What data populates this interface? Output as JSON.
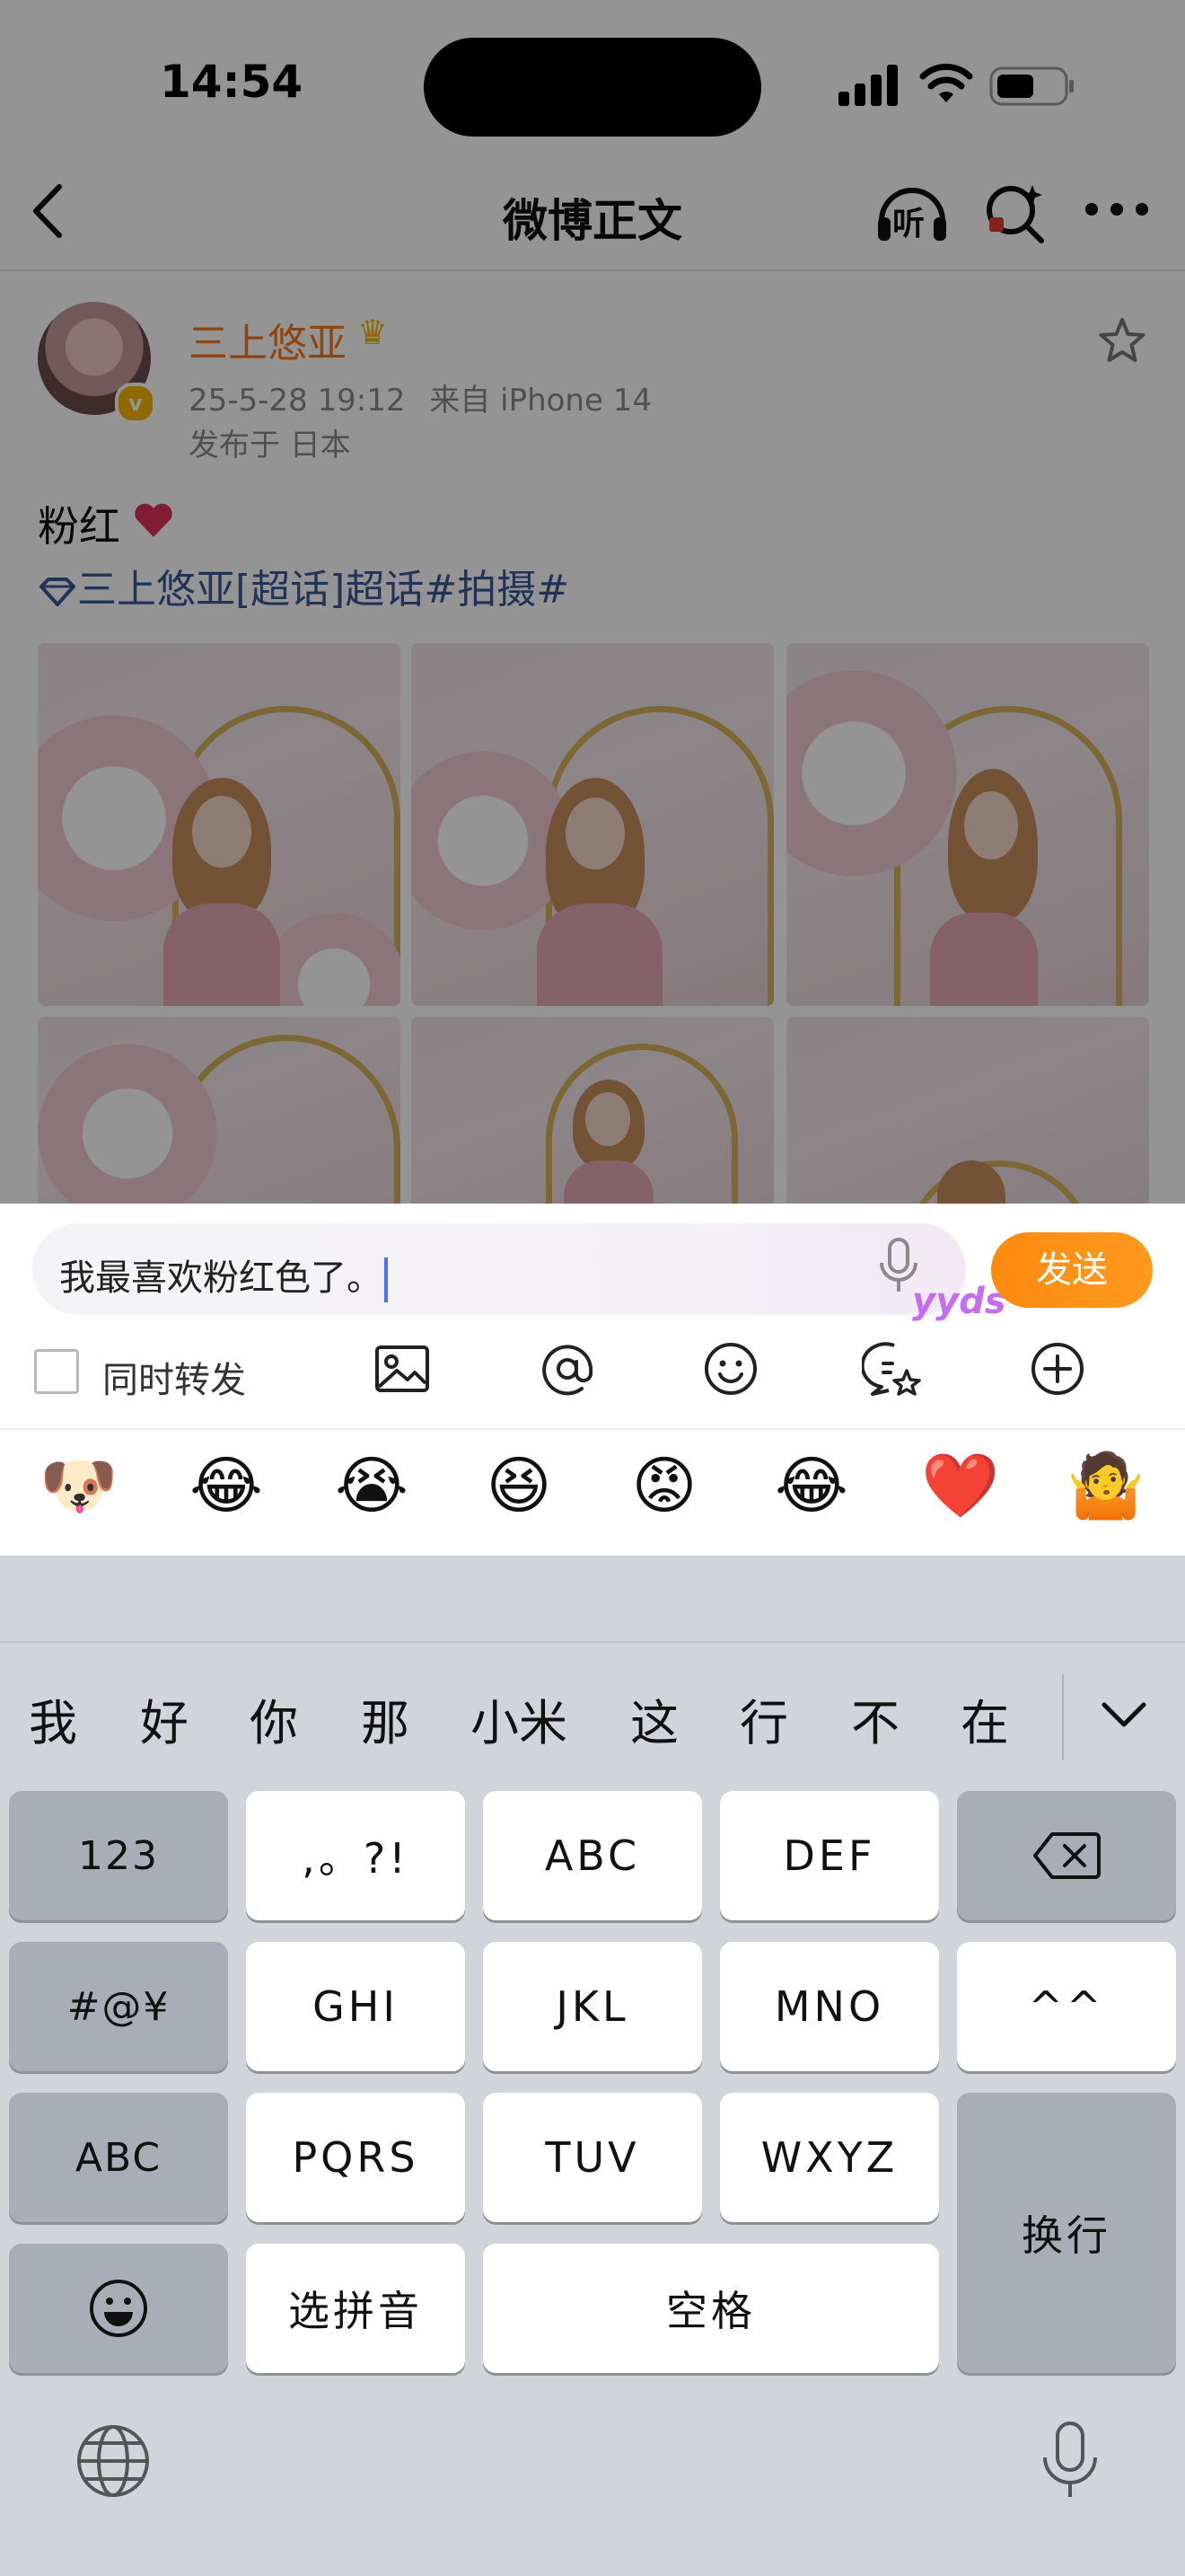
{
  "status_bar": {
    "time": "14:54"
  },
  "nav": {
    "title": "微博正文",
    "listen_label": "听"
  },
  "post": {
    "username": "三上悠亚",
    "timestamp": "25-5-28 19:12",
    "source": "来自 iPhone 14",
    "location": "发布于 日本",
    "text": "粉红",
    "topic": "三上悠亚[超话]超话#拍摄#"
  },
  "composer": {
    "input_value": "我最喜欢粉红色了。",
    "sticker_text": "yyds",
    "send_label": "发送",
    "repost_label": "同时转发",
    "tools": [
      "image-icon",
      "at-icon",
      "emoji-icon",
      "sticker-icon",
      "add-icon"
    ],
    "emojis": [
      "🐶",
      "😂",
      "😭",
      "😆",
      "😡",
      "😂",
      "❤️",
      "🤷"
    ]
  },
  "keyboard": {
    "candidates": [
      "我",
      "好",
      "你",
      "那",
      "小米",
      "这",
      "行",
      "不",
      "在"
    ],
    "keys": {
      "num": "123",
      "punct": ",。?!",
      "abc2": "ABC",
      "def": "DEF",
      "sym": "#@¥",
      "ghi": "GHI",
      "jkl": "JKL",
      "mno": "MNO",
      "face": "^^",
      "abc": "ABC",
      "pqrs": "PQRS",
      "tuv": "TUV",
      "wxyz": "WXYZ",
      "enter": "换行",
      "pinyin": "选拼音",
      "space": "空格"
    }
  },
  "colors": {
    "accent": "#FF8A0F",
    "username": "#F7771D",
    "link": "#3B5998"
  }
}
